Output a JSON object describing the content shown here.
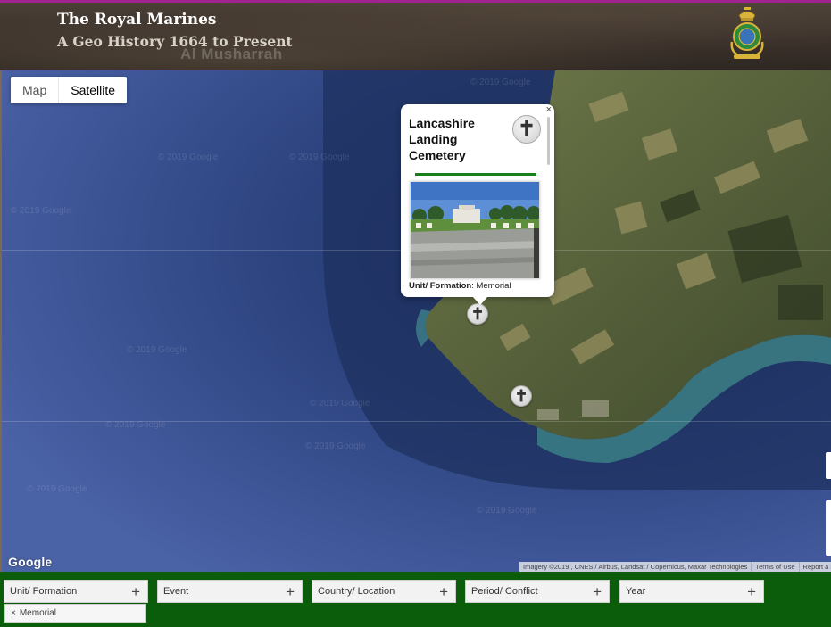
{
  "header": {
    "title": "The Royal Marines",
    "subtitle": "A Geo History 1664 to Present",
    "background_map_label": "Al Musharrah",
    "accent_color": "#a0238f"
  },
  "map": {
    "map_type_buttons": [
      {
        "label": "Map",
        "active": false
      },
      {
        "label": "Satellite",
        "active": true
      }
    ],
    "watermark_text": "© 2019 Google",
    "google_logo": "Google",
    "attribution": {
      "imagery": "Imagery ©2019 , CNES / Airbus, Landsat / Copernicus, Maxar Technologies",
      "terms": "Terms of Use",
      "report": "Report a m"
    },
    "markers": [
      {
        "name": "memorial-marker-lancashire",
        "icon": "cross-icon"
      },
      {
        "name": "memorial-marker-2",
        "icon": "cross-icon"
      }
    ]
  },
  "info_window": {
    "title": "Lancashire Landing Cemetery",
    "close_glyph": "×",
    "icon": "cross-icon",
    "field_label": "Unit/ Formation",
    "field_value": "Memorial",
    "accent_color": "#1a7e1a"
  },
  "filters": {
    "items": [
      {
        "label": "Unit/ Formation"
      },
      {
        "label": "Event"
      },
      {
        "label": "Country/ Location"
      },
      {
        "label": "Period/ Conflict"
      },
      {
        "label": "Year"
      }
    ],
    "plus_glyph": "+",
    "active_chip": {
      "label": "Memorial",
      "remove_glyph": "×"
    },
    "bar_color": "#0b5d0b"
  }
}
